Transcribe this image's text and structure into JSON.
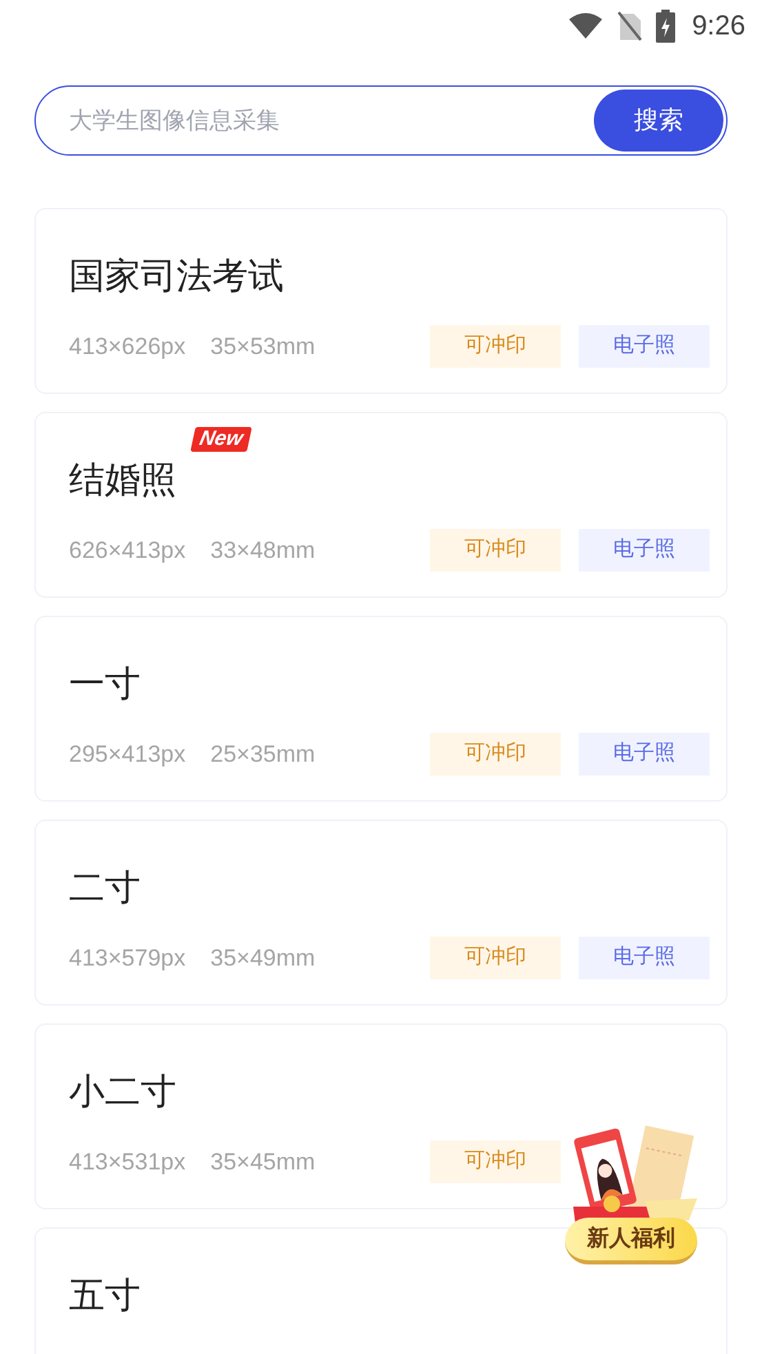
{
  "status_bar": {
    "time": "9:26"
  },
  "search": {
    "placeholder": "大学生图像信息采集",
    "button": "搜索"
  },
  "cards": [
    {
      "title": "国家司法考试",
      "pixels": "413×626px",
      "size": "35×53mm",
      "tags": [
        {
          "label": "可冲印",
          "kind": "print"
        },
        {
          "label": "电子照",
          "kind": "digital"
        }
      ]
    },
    {
      "title": "结婚照",
      "new_badge": "New",
      "pixels": "626×413px",
      "size": "33×48mm",
      "tags": [
        {
          "label": "可冲印",
          "kind": "print"
        },
        {
          "label": "电子照",
          "kind": "digital"
        }
      ]
    },
    {
      "title": "一寸",
      "pixels": "295×413px",
      "size": "25×35mm",
      "tags": [
        {
          "label": "可冲印",
          "kind": "print"
        },
        {
          "label": "电子照",
          "kind": "digital"
        }
      ]
    },
    {
      "title": "二寸",
      "pixels": "413×579px",
      "size": "35×49mm",
      "tags": [
        {
          "label": "可冲印",
          "kind": "print"
        },
        {
          "label": "电子照",
          "kind": "digital"
        }
      ]
    },
    {
      "title": "小二寸",
      "pixels": "413×531px",
      "size": "35×45mm",
      "tags": [
        {
          "label": "可冲印",
          "kind": "print"
        }
      ]
    },
    {
      "title": "五寸"
    }
  ],
  "promo": {
    "label": "新人福利"
  }
}
